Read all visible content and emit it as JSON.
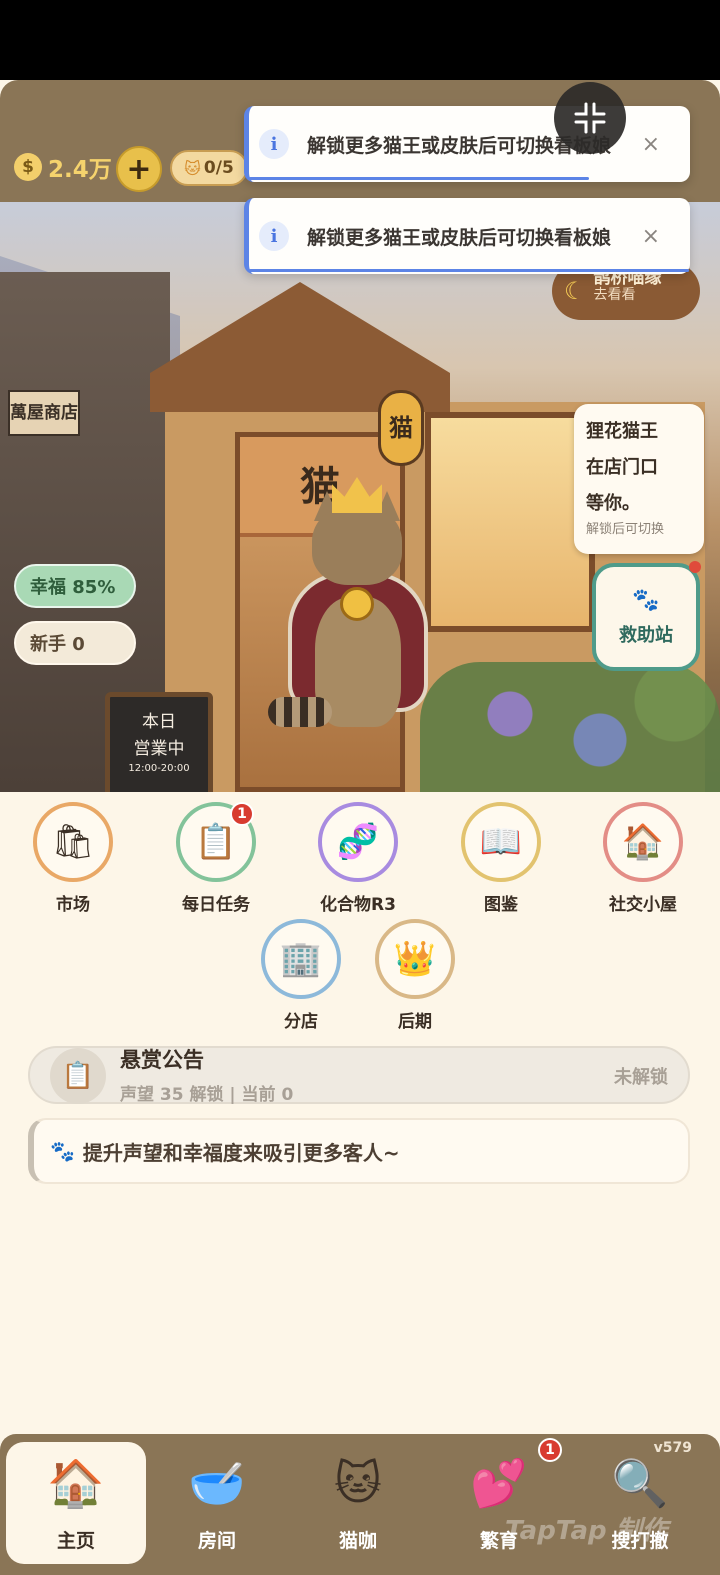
{
  "topbar": {
    "coin_value": "2.4万",
    "plus_label": "+",
    "cat_count": "0/5"
  },
  "toasts": [
    {
      "text": "解锁更多猫王或皮肤后可切换看板娘",
      "close": "×"
    },
    {
      "text": "解锁更多猫王或皮肤后可切换看板娘",
      "close": "×"
    }
  ],
  "scene": {
    "left_shop_sign": "萬屋商店",
    "noren_text": "猫",
    "lantern_text": "猫",
    "sign_line1": "本日",
    "sign_line2": "営業中",
    "sign_hours": "12:00-20:00",
    "happiness_label": "幸福 85%",
    "newbie_label": "新手 0",
    "event_title": "鹊桥喵缘",
    "event_action": "去看看",
    "bubble_text": "狸花猫王\n在店门口\n等你。",
    "bubble_hint": "解锁后可切换",
    "rescue_label": "救助站"
  },
  "grid": [
    {
      "label": "市场",
      "icon": "shopping-bag-icon",
      "color": "#e9a866"
    },
    {
      "label": "每日任务",
      "icon": "clipboard-icon",
      "color": "#83c39a",
      "badge": "1"
    },
    {
      "label": "化合物R3",
      "icon": "dna-icon",
      "color": "#a88be0"
    },
    {
      "label": "图鉴",
      "icon": "book-icon",
      "color": "#e2c36f"
    },
    {
      "label": "社交小屋",
      "icon": "house-icon",
      "color": "#e38d86"
    },
    {
      "label": "分店",
      "icon": "building-icon",
      "color": "#8db9da"
    },
    {
      "label": "后期",
      "icon": "crown-icon",
      "color": "#d9b887"
    }
  ],
  "bounty": {
    "title": "悬赏公告",
    "subtitle": "声望 35 解锁 | 当前 0",
    "state": "未解锁"
  },
  "tip": {
    "text": "提升声望和幸福度来吸引更多客人~"
  },
  "nav": {
    "items": [
      {
        "label": "主页",
        "icon": "home-icon"
      },
      {
        "label": "房间",
        "icon": "bowl-icon"
      },
      {
        "label": "猫咖",
        "icon": "cat-cup-icon"
      },
      {
        "label": "繁育",
        "icon": "cats-heart-icon",
        "badge": "1"
      },
      {
        "label": "搜打撤",
        "icon": "map-search-icon"
      }
    ],
    "version": "v579",
    "watermark": "TapTap 制作"
  }
}
